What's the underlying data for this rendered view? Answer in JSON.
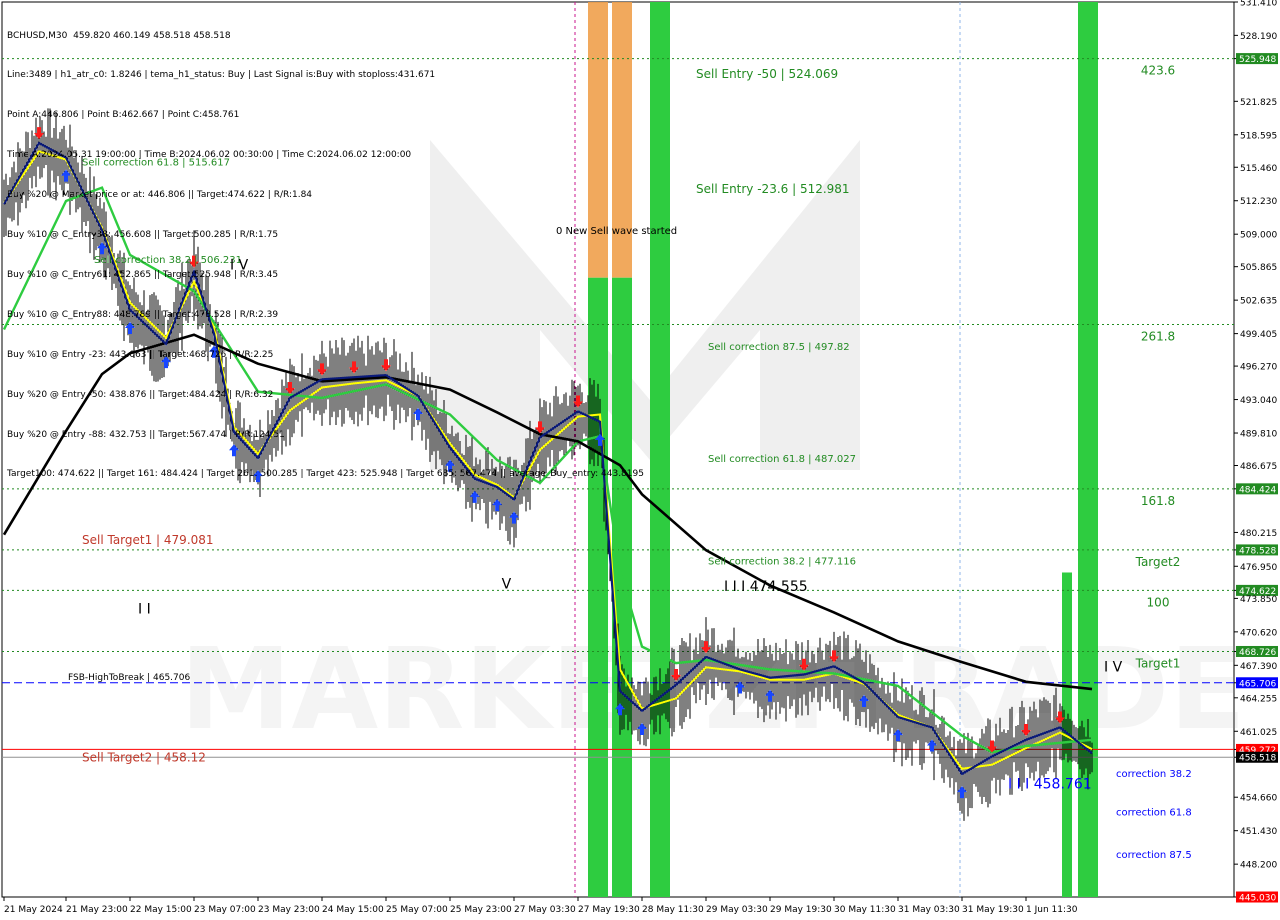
{
  "header": {
    "lines": [
      "BCHUSD,M30  459.820 460.149 458.518 458.518",
      "Line:3489 | h1_atr_c0: 1.8246 | tema_h1_status: Buy | Last Signal is:Buy with stoploss:431.671",
      "Point A:446.806 | Point B:462.667 | Point C:458.761",
      "Time A:2024.05.31 19:00:00 | Time B:2024.06.02 00:30:00 | Time C:2024.06.02 12:00:00",
      "Buy %20 @ Market price or at: 446.806 || Target:474.622 | R/R:1.84",
      "Buy %10 @ C_Entry38: 456.608 || Target:500.285 | R/R:1.75",
      "Buy %10 @ C_Entry61: 452.865 || Target:525.948 | R/R:3.45",
      "Buy %10 @ C_Entry88: 448.789 || Target:478.528 | R/R:2.39",
      "Buy %10 @ Entry -23: 443.063 || Target:468.726 | R/R:2.25",
      "Buy %20 @ Entry -50: 438.876 || Target:484.424 | R/R:6.32",
      "Buy %20 @ Entry -88: 432.753 || Target:567.474 | R/R:124.51",
      "Target100: 474.622 || Target 161: 484.424 | Target 261: 500.285 | Target 423: 525.948 | Target 685: 567.474 || average_Buy_entry: 443.8195"
    ]
  },
  "chart_data": {
    "type": "line",
    "symbol": "BCHUSD",
    "timeframe": "M30",
    "ylim": [
      445.03,
      531.41
    ],
    "price_ticks": [
      "531.410",
      "528.190",
      "525.948",
      "521.825",
      "518.595",
      "515.460",
      "512.230",
      "509.000",
      "505.865",
      "502.635",
      "499.405",
      "496.270",
      "493.040",
      "489.810",
      "486.675",
      "484.424",
      "480.215",
      "478.528",
      "476.950",
      "474.622",
      "473.850",
      "470.620",
      "468.726",
      "467.390",
      "465.706",
      "464.255",
      "461.025",
      "459.272",
      "458.518",
      "454.660",
      "451.430",
      "448.200",
      "445.030"
    ],
    "time_labels": [
      "21 May 2024",
      "21 May 23:00",
      "22 May 15:00",
      "23 May 07:00",
      "23 May 23:00",
      "24 May 15:00",
      "25 May 07:00",
      "25 May 23:00",
      "27 May 03:30",
      "27 May 19:30",
      "28 May 11:30",
      "29 May 03:30",
      "29 May 19:30",
      "30 May 11:30",
      "31 May 03:30",
      "31 May 19:30",
      "1 Jun 11:30"
    ],
    "levels": [
      {
        "name": "423.6",
        "price": 525.948,
        "label": "525.948",
        "color": "#228B22"
      },
      {
        "name": "261.8",
        "price": 500.285,
        "label": "500.285",
        "color": "#228B22"
      },
      {
        "name": "161.8",
        "price": 484.424,
        "label": "484.424",
        "color": "#228B22"
      },
      {
        "name": "Target2",
        "price": 478.528,
        "label": "478.528",
        "color": "#228B22"
      },
      {
        "name": "100",
        "price": 474.622,
        "label": "474.622",
        "color": "#228B22"
      },
      {
        "name": "Target1",
        "price": 468.726,
        "label": "468.726",
        "color": "#228B22"
      }
    ],
    "fsb_line": {
      "label": "FSB-HighToBreak | 465.706",
      "price": 465.706,
      "axis_label": "465.706",
      "color": "#0000ff"
    },
    "red_line": {
      "price": 459.272,
      "axis_label": "459.272",
      "color": "#ff0000"
    },
    "current_price": {
      "price": 458.518,
      "axis_label": "458.518"
    },
    "bottom_price": {
      "price": 445.03,
      "axis_label": "445.030"
    },
    "annotations": [
      {
        "text": "Sell Entry -50 | 524.069",
        "x": "29 May 01:00",
        "y": 524.069,
        "color": "#228B22",
        "size": 12
      },
      {
        "text": "Sell Entry -23.6 | 512.981",
        "x": "29 May 01:00",
        "y": 512.981,
        "color": "#228B22",
        "size": 12
      },
      {
        "text": "0 New Sell wave started",
        "x": "27 May 14:00",
        "y": 509.0,
        "color": "#000000",
        "size": 10
      },
      {
        "text": "Sell correction 87.5 | 497.82",
        "x": "29 May 04:00",
        "y": 497.82,
        "color": "#228B22",
        "size": 10
      },
      {
        "text": "Sell correction 61.8 | 487.027",
        "x": "29 May 04:00",
        "y": 487.027,
        "color": "#228B22",
        "size": 10
      },
      {
        "text": "Sell correction 38.2 | 477.116",
        "x": "29 May 04:00",
        "y": 477.116,
        "color": "#228B22",
        "size": 10
      },
      {
        "text": "Sell correction 61.8 | 515.617",
        "x": "22 May 03:00",
        "y": 515.617,
        "color": "#228B22",
        "size": 10
      },
      {
        "text": "Sell correction 38.2 | 506.231",
        "x": "22 May 06:00",
        "y": 506.231,
        "color": "#228B22",
        "size": 10
      },
      {
        "text": "I I I  474.555",
        "x": "29 May 08:00",
        "y": 474.555,
        "color": "#000000",
        "size": 14
      },
      {
        "text": "I V",
        "x": "23 May 16:00",
        "y": 505.6,
        "color": "#000000",
        "size": 14
      },
      {
        "text": "V",
        "x": "26 May 22:00",
        "y": 474.8,
        "color": "#000000",
        "size": 14
      },
      {
        "text": "I I",
        "x": "22 May 17:00",
        "y": 472.4,
        "color": "#000000",
        "size": 14
      },
      {
        "text": "I V",
        "x": "2 Jun 07:00",
        "y": 466.8,
        "color": "#000000",
        "size": 14
      },
      {
        "text": "I I I  458.761",
        "x": "1 Jun 07:00",
        "y": 455.5,
        "color": "#0000ff",
        "size": 14
      },
      {
        "text": "correction 38.2",
        "x": "2 Jun 10:00",
        "y": 456.6,
        "color": "#0000ff",
        "size": 10
      },
      {
        "text": "correction 61.8",
        "x": "2 Jun 10:00",
        "y": 452.9,
        "color": "#0000ff",
        "size": 10
      },
      {
        "text": "correction 87.5",
        "x": "2 Jun 10:00",
        "y": 448.8,
        "color": "#0000ff",
        "size": 10
      },
      {
        "text": "Sell Target1 | 479.081",
        "x": "22 May 03:00",
        "y": 479.081,
        "color": "#c0392b",
        "size": 12
      },
      {
        "text": "Sell Target2 | 458.12",
        "x": "22 May 03:00",
        "y": 458.12,
        "color": "#c0392b",
        "size": 12
      }
    ],
    "watermark": "MARKETZITRADE",
    "series": [
      {
        "name": "close",
        "color": "#000000",
        "x": [
          "21 May 2024",
          "21 May 13:00",
          "21 May 23:00",
          "22 May 08:00",
          "22 May 15:00",
          "23 May 00:00",
          "23 May 07:00",
          "23 May 12:00",
          "23 May 17:00",
          "23 May 23:00",
          "24 May 07:00",
          "24 May 15:00",
          "24 May 23:00",
          "25 May 07:00",
          "25 May 15:00",
          "25 May 23:00",
          "26 May 10:00",
          "26 May 20:00",
          "27 May 03:30",
          "27 May 10:00",
          "27 May 19:30",
          "28 May 01:00",
          "28 May 06:00",
          "28 May 11:30",
          "28 May 20:00",
          "29 May 03:30",
          "29 May 12:00",
          "29 May 19:30",
          "30 May 04:00",
          "30 May 11:30",
          "30 May 19:00",
          "31 May 03:30",
          "31 May 12:00",
          "31 May 19:30",
          "1 Jun 03:00",
          "1 Jun 11:30",
          "1 Jun 20:00",
          "2 Jun 04:00"
        ],
        "values": [
          511.5,
          517.4,
          516.0,
          509.0,
          501.3,
          498.0,
          505.0,
          499.0,
          489.5,
          487.0,
          492.8,
          494.6,
          494.8,
          495.0,
          493.0,
          488.0,
          485.0,
          484.2,
          483.0,
          489.0,
          491.5,
          490.5,
          464.5,
          462.6,
          465.1,
          467.8,
          466.6,
          465.8,
          466.1,
          466.9,
          465.3,
          462.0,
          461.0,
          456.5,
          458.2,
          459.8,
          461.0,
          458.5
        ]
      },
      {
        "name": "tema",
        "color": "#ffff00",
        "x": [
          "21 May 2024",
          "21 May 13:00",
          "21 May 23:00",
          "22 May 08:00",
          "22 May 15:00",
          "23 May 00:00",
          "23 May 07:00",
          "23 May 12:00",
          "23 May 17:00",
          "23 May 23:00",
          "24 May 07:00",
          "24 May 15:00",
          "24 May 23:00",
          "25 May 07:00",
          "25 May 15:00",
          "25 May 23:00",
          "26 May 10:00",
          "26 May 20:00",
          "27 May 03:30",
          "27 May 10:00",
          "27 May 19:30",
          "28 May 01:00",
          "28 May 06:00",
          "28 May 11:30",
          "28 May 20:00",
          "29 May 03:30",
          "29 May 12:00",
          "29 May 19:30",
          "30 May 04:00",
          "30 May 11:30",
          "30 May 19:00",
          "31 May 03:30",
          "31 May 12:00",
          "31 May 19:30",
          "1 Jun 03:00",
          "1 Jun 11:30",
          "1 Jun 20:00",
          "2 Jun 04:00"
        ],
        "values": [
          512.0,
          517.0,
          516.2,
          509.6,
          502.4,
          499.0,
          504.4,
          500.0,
          490.4,
          487.8,
          492.0,
          494.2,
          494.6,
          494.9,
          493.4,
          488.8,
          485.8,
          484.8,
          483.6,
          488.2,
          491.4,
          491.6,
          467.0,
          463.2,
          464.2,
          467.2,
          466.8,
          466.0,
          466.0,
          466.6,
          465.6,
          462.6,
          461.4,
          457.4,
          457.8,
          459.4,
          460.9,
          459.3
        ]
      },
      {
        "name": "ma-green",
        "color": "#2ecc40",
        "x": [
          "21 May 2024",
          "21 May 23:00",
          "22 May 08:00",
          "22 May 15:00",
          "23 May 07:00",
          "23 May 23:00",
          "24 May 15:00",
          "25 May 07:00",
          "25 May 23:00",
          "26 May 20:00",
          "27 May 10:00",
          "27 May 19:30",
          "28 May 01:00",
          "28 May 06:00",
          "28 May 11:30",
          "28 May 20:00",
          "29 May 03:30",
          "29 May 19:30",
          "30 May 11:30",
          "31 May 03:30",
          "31 May 19:30",
          "1 Jun 03:00",
          "1 Jun 11:30",
          "2 Jun 04:00"
        ],
        "values": [
          499.8,
          512.2,
          513.5,
          507.0,
          503.5,
          493.8,
          493.2,
          494.5,
          491.6,
          487.2,
          485.0,
          489.0,
          489.5,
          476.5,
          469.2,
          467.6,
          467.9,
          467.0,
          466.6,
          465.4,
          460.6,
          459.0,
          459.6,
          460.2
        ]
      },
      {
        "name": "ema-black",
        "color": "#000000",
        "x": [
          "21 May 2024",
          "21 May 23:00",
          "22 May 08:00",
          "22 May 15:00",
          "23 May 07:00",
          "23 May 23:00",
          "24 May 15:00",
          "25 May 07:00",
          "25 May 23:00",
          "26 May 20:00",
          "27 May 10:00",
          "27 May 19:30",
          "28 May 06:00",
          "28 May 11:30",
          "29 May 03:30",
          "29 May 19:30",
          "30 May 11:30",
          "31 May 03:30",
          "31 May 19:30",
          "1 Jun 11:30",
          "2 Jun 04:00"
        ],
        "values": [
          480.0,
          490.0,
          495.5,
          497.5,
          499.3,
          496.5,
          494.8,
          495.2,
          494.0,
          491.8,
          489.7,
          489.0,
          486.7,
          483.9,
          478.5,
          475.1,
          472.5,
          469.7,
          467.7,
          465.8,
          465.1
        ]
      }
    ],
    "zones": [
      {
        "x0": "27 May 22:00",
        "x1": "28 May 03:00",
        "y0": 445.03,
        "y1": 531.41,
        "colors": [
          "#f0a04b",
          "#2ecc40"
        ],
        "split": 504.8
      },
      {
        "x0": "28 May 04:00",
        "x1": "28 May 09:00",
        "y0": 445.03,
        "y1": 531.41,
        "colors": [
          "#f0a04b",
          "#2ecc40"
        ],
        "split": 504.8
      },
      {
        "x0": "28 May 13:30",
        "x1": "28 May 18:30",
        "y0": 445.03,
        "y1": 531.41,
        "colors": [
          "#2ecc40"
        ]
      },
      {
        "x0": "1 Jun 20:30",
        "x1": "1 Jun 23:00",
        "y0": 445.03,
        "y1": 476.35,
        "colors": [
          "#2ecc40"
        ]
      },
      {
        "x0": "2 Jun 00:30",
        "x1": "2 Jun 05:30",
        "y0": 445.03,
        "y1": 531.41,
        "colors": [
          "#2ecc40"
        ]
      }
    ]
  }
}
